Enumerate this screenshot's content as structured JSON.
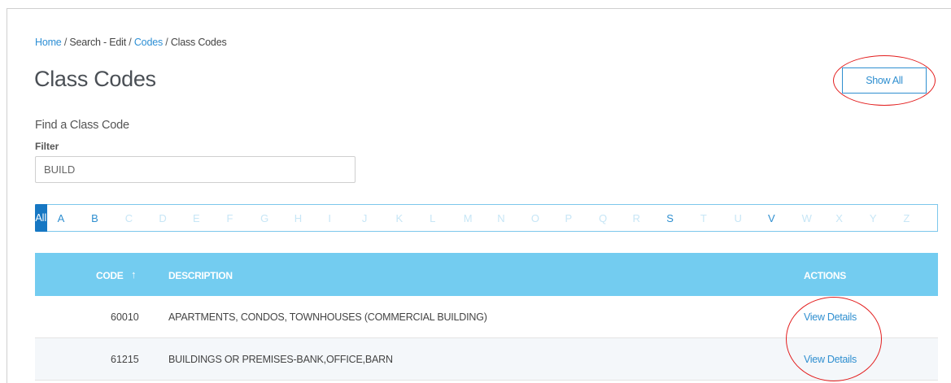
{
  "breadcrumb": {
    "home": "Home",
    "sep1": " / ",
    "search_edit": "Search - Edit",
    "sep2": " / ",
    "codes": "Codes",
    "sep3": " / ",
    "current": "Class Codes"
  },
  "page": {
    "title": "Class Codes",
    "show_all_label": "Show All"
  },
  "find": {
    "title": "Find a Class Code",
    "filter_label": "Filter",
    "filter_value": "BUILD"
  },
  "alphabet": {
    "all_label": "All",
    "letters": [
      {
        "l": "A",
        "on": true
      },
      {
        "l": "B",
        "on": true
      },
      {
        "l": "C",
        "on": false
      },
      {
        "l": "D",
        "on": false
      },
      {
        "l": "E",
        "on": false
      },
      {
        "l": "F",
        "on": false
      },
      {
        "l": "G",
        "on": false
      },
      {
        "l": "H",
        "on": false
      },
      {
        "l": "I",
        "on": false
      },
      {
        "l": "J",
        "on": false
      },
      {
        "l": "K",
        "on": false
      },
      {
        "l": "L",
        "on": false
      },
      {
        "l": "M",
        "on": false
      },
      {
        "l": "N",
        "on": false
      },
      {
        "l": "O",
        "on": false
      },
      {
        "l": "P",
        "on": false
      },
      {
        "l": "Q",
        "on": false
      },
      {
        "l": "R",
        "on": false
      },
      {
        "l": "S",
        "on": true
      },
      {
        "l": "T",
        "on": false
      },
      {
        "l": "U",
        "on": false
      },
      {
        "l": "V",
        "on": true
      },
      {
        "l": "W",
        "on": false
      },
      {
        "l": "X",
        "on": false
      },
      {
        "l": "Y",
        "on": false
      },
      {
        "l": "Z",
        "on": false
      }
    ]
  },
  "table": {
    "headers": {
      "code": "CODE",
      "sort_icon": "arrow-up-icon",
      "sort_glyph": "↑",
      "description": "DESCRIPTION",
      "actions": "ACTIONS"
    },
    "rows": [
      {
        "code": "60010",
        "description": "APARTMENTS, CONDOS, TOWNHOUSES (COMMERCIAL BUILDING)",
        "action": "View Details"
      },
      {
        "code": "61215",
        "description": "BUILDINGS OR PREMISES-BANK,OFFICE,BARN",
        "action": "View Details"
      }
    ]
  },
  "colors": {
    "accent": "#2f8fd0",
    "header_bg": "#73ccf0",
    "active_tab": "#1677c3",
    "annotation": "#e31d1d"
  }
}
